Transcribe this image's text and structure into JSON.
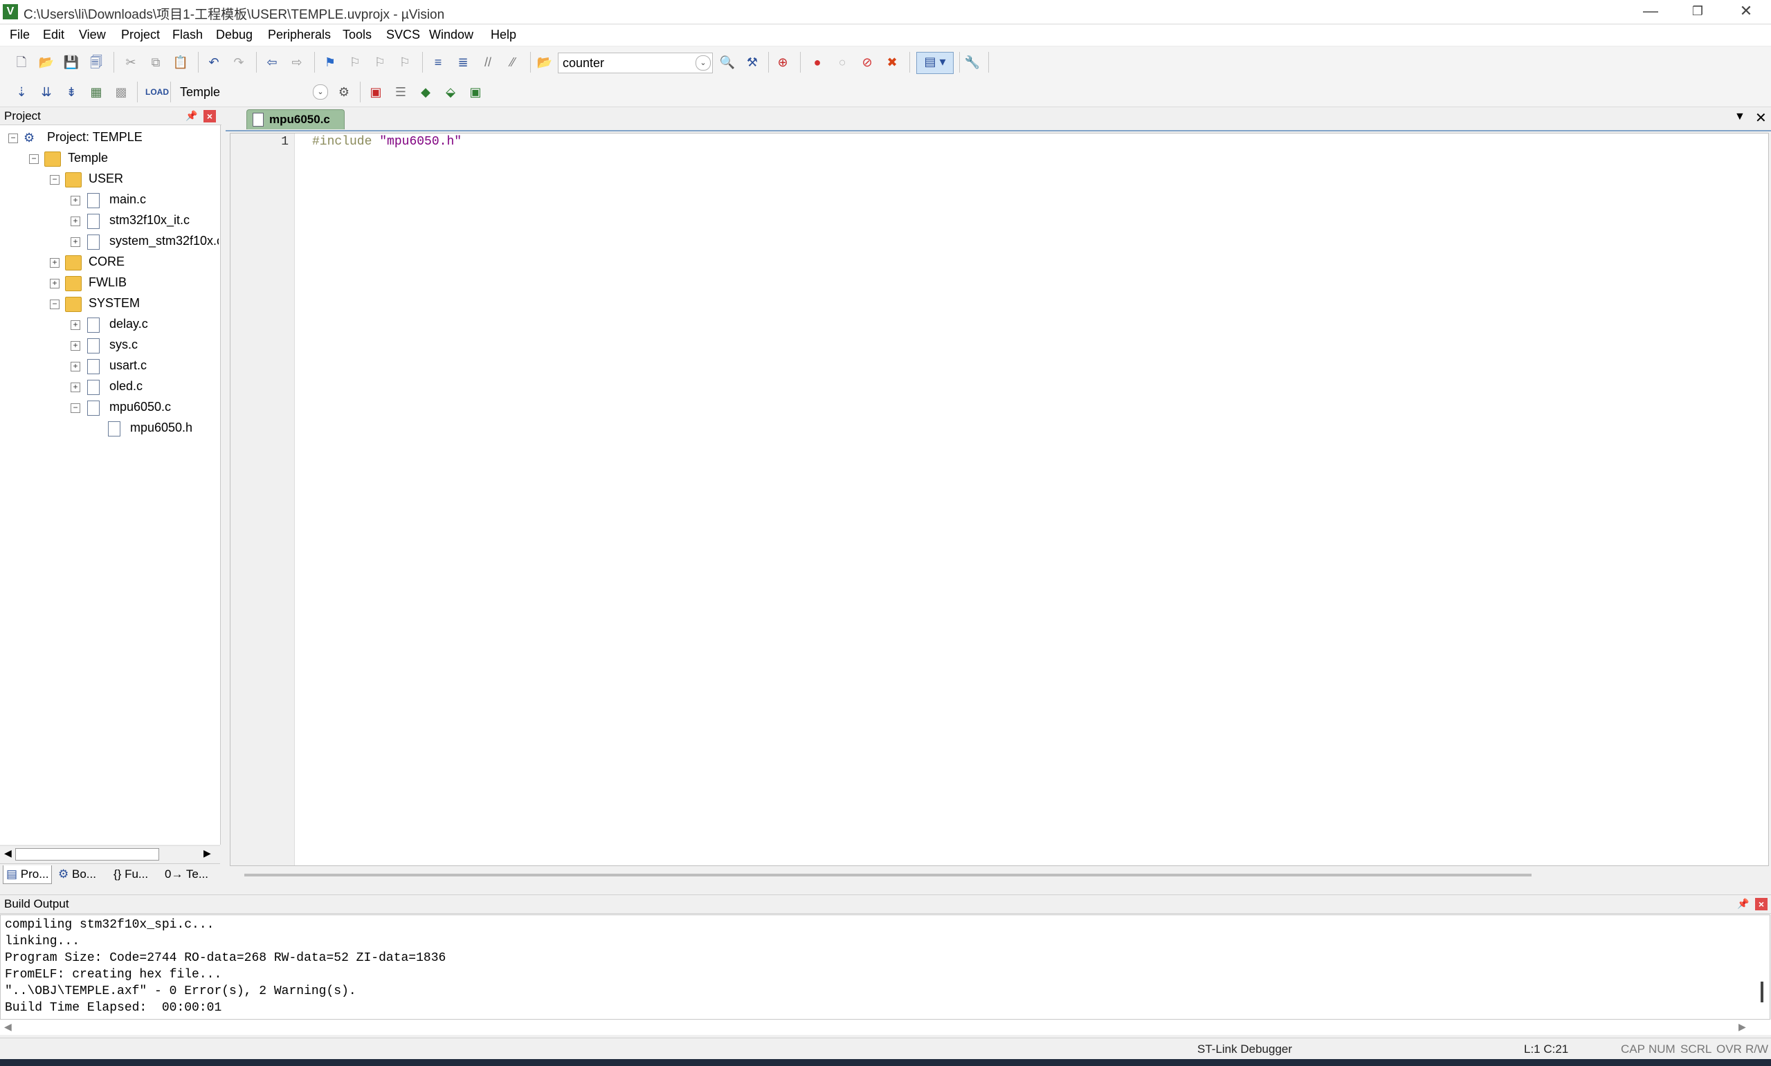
{
  "window": {
    "title": "C:\\Users\\li\\Downloads\\项目1-工程模板\\USER\\TEMPLE.uvprojx - µVision",
    "minimize": "—",
    "restore": "❐",
    "close": "✕"
  },
  "menu": [
    "File",
    "Edit",
    "View",
    "Project",
    "Flash",
    "Debug",
    "Peripherals",
    "Tools",
    "SVCS",
    "Window",
    "Help"
  ],
  "toolbar": {
    "find_combo_value": "counter",
    "target_combo_value": "Temple"
  },
  "project_pane": {
    "title": "Project",
    "root": "Project: TEMPLE",
    "target": "Temple",
    "groups": [
      {
        "name": "USER",
        "files": [
          "main.c",
          "stm32f10x_it.c",
          "system_stm32f10x.c"
        ]
      },
      {
        "name": "CORE"
      },
      {
        "name": "FWLIB"
      },
      {
        "name": "SYSTEM",
        "files": [
          "delay.c",
          "sys.c",
          "usart.c",
          "oled.c",
          "mpu6050.c"
        ],
        "sub": "mpu6050.h"
      }
    ],
    "tabs": [
      "Pro...",
      "Bo...",
      "{} Fu...",
      "0→ Te..."
    ]
  },
  "editor": {
    "tab": "mpu6050.c",
    "line_number": "1",
    "code_keyword": "#include",
    "code_string": "\"mpu6050.h\""
  },
  "build_output": {
    "title": "Build Output",
    "lines": [
      "compiling stm32f10x_spi.c...",
      "linking...",
      "Program Size: Code=2744 RO-data=268 RW-data=52 ZI-data=1836",
      "FromELF: creating hex file...",
      "\"..\\OBJ\\TEMPLE.axf\" - 0 Error(s), 2 Warning(s).",
      "Build Time Elapsed:  00:00:01"
    ]
  },
  "status": {
    "debugger": "ST-Link Debugger",
    "cursor": "L:1 C:21",
    "cap": "CAP",
    "num": "NUM",
    "scrl": "SCRL",
    "ovr": "OVR",
    "rw": "R/W"
  },
  "colors": {
    "tab_active": "#9ec09e",
    "close_red": "#e04a4a",
    "string_purple": "#800080"
  }
}
